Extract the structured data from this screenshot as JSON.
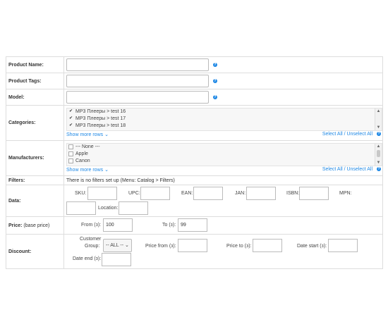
{
  "product_name": {
    "label": "Product Name:",
    "value": ""
  },
  "product_tags": {
    "label": "Product Tags:",
    "value": ""
  },
  "model": {
    "label": "Model:",
    "value": ""
  },
  "help_icon": "?",
  "categories": {
    "label": "Categories:",
    "items": [
      {
        "text": "MP3 Плееры  >  test 16",
        "checked": true
      },
      {
        "text": "MP3 Плееры  >  test 17",
        "checked": true
      },
      {
        "text": "MP3 Плееры  >  test 18",
        "checked": true
      }
    ],
    "show_more": "Show more rows",
    "select_all": "Select All",
    "separator": " / ",
    "unselect_all": "Unselect All"
  },
  "manufacturers": {
    "label": "Manufacturers:",
    "items": [
      {
        "text": "--- None ---",
        "checked": false
      },
      {
        "text": "Apple",
        "checked": false
      },
      {
        "text": "Canon",
        "checked": false
      }
    ],
    "show_more": "Show more rows",
    "select_all": "Select All",
    "separator": " / ",
    "unselect_all": "Unselect All"
  },
  "filters": {
    "label": "Filters:",
    "text": "There is no filters set up (Menu: Catalog > Filters)"
  },
  "data": {
    "label": "Data:",
    "sku": "SKU:",
    "upc": "UPC:",
    "ean": "EAN:",
    "jan": "JAN:",
    "isbn": "ISBN:",
    "mpn": "MPN:",
    "location": "Location:"
  },
  "price": {
    "label": "Price:",
    "label_note": "(base price)",
    "from_label": "From (з):",
    "from_value": "100",
    "to_label": "To (з):",
    "to_value": "99"
  },
  "discount": {
    "label": "Discount:",
    "customer_group_line1": "Customer",
    "customer_group_line2": "Group:",
    "customer_group_value": "-- ALL --",
    "price_from": "Price from (з):",
    "price_to": "Price to (з):",
    "date_start": "Date start (з):",
    "date_end": "Date end (з):"
  },
  "colors": {
    "accent": "#1e88e5",
    "border": "#dddddd"
  }
}
